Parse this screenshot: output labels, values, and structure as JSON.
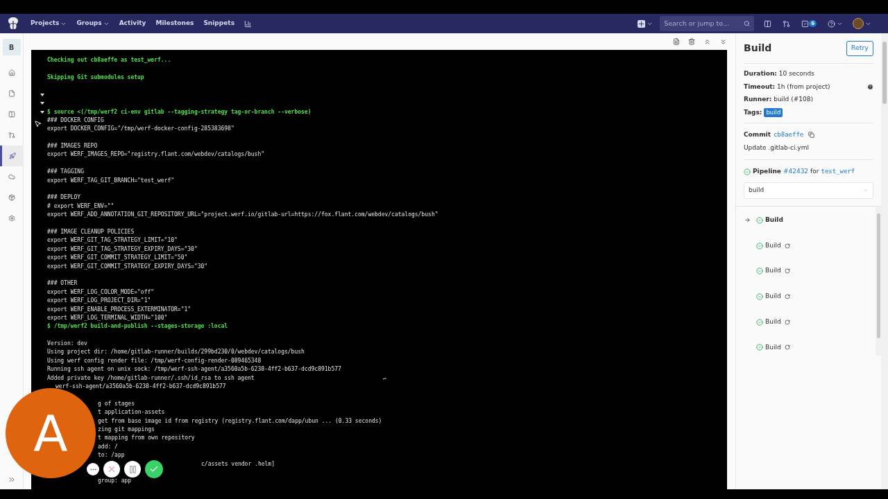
{
  "navbar": {
    "menus": [
      {
        "label": "Projects",
        "dropdown": true
      },
      {
        "label": "Groups",
        "dropdown": true
      },
      {
        "label": "Activity",
        "dropdown": false
      },
      {
        "label": "Milestones",
        "dropdown": false
      },
      {
        "label": "Snippets",
        "dropdown": false
      }
    ],
    "search": {
      "placeholder": "Search or jump to…"
    },
    "todo_count": "6"
  },
  "project_sidebar": {
    "avatar_letter": "B",
    "items": [
      {
        "kind": "home",
        "selected": false
      },
      {
        "kind": "repository",
        "selected": false
      },
      {
        "kind": "issues",
        "selected": false
      },
      {
        "kind": "merge-requests",
        "selected": false
      },
      {
        "kind": "ci-cd",
        "selected": true
      },
      {
        "kind": "operations",
        "selected": false
      },
      {
        "kind": "packages",
        "selected": false
      },
      {
        "kind": "settings",
        "selected": false
      }
    ]
  },
  "log": [
    {
      "kind": "command",
      "text": "Checking out cb8aeffe as test_werf..."
    },
    {
      "kind": "blank"
    },
    {
      "kind": "command",
      "text": "Skipping Git submodules setup"
    },
    {
      "kind": "blank"
    },
    {
      "kind": "section"
    },
    {
      "kind": "section"
    },
    {
      "kind": "section-command",
      "text": "$ source <(/tmp/werf2 ci-env gitlab --tagging-strategy tag-or-branch --verbose)"
    },
    {
      "kind": "output",
      "text": "### DOCKER CONFIG"
    },
    {
      "kind": "output",
      "text": "export DOCKER_CONFIG=\"/tmp/werf-docker-config-285383698\""
    },
    {
      "kind": "blank"
    },
    {
      "kind": "output",
      "text": "### IMAGES REPO"
    },
    {
      "kind": "output",
      "text": "export WERF_IMAGES_REPO=\"registry.flant.com/webdev/catalogs/bush\""
    },
    {
      "kind": "blank"
    },
    {
      "kind": "output",
      "text": "### TAGGING"
    },
    {
      "kind": "output",
      "text": "export WERF_TAG_GIT_BRANCH=\"test_werf\""
    },
    {
      "kind": "blank"
    },
    {
      "kind": "output",
      "text": "### DEPLOY"
    },
    {
      "kind": "output",
      "text": "# export WERF_ENV=\"\""
    },
    {
      "kind": "output",
      "text": "export WERF_ADD_ANNOTATION_GIT_REPOSITORY_URL=\"project.werf.io/gitlab-url=https://fox.flant.com/webdev/catalogs/bush\""
    },
    {
      "kind": "blank"
    },
    {
      "kind": "output",
      "text": "### IMAGE CLEANUP POLICIES"
    },
    {
      "kind": "output",
      "text": "export WERF_GIT_TAG_STRATEGY_LIMIT=\"10\""
    },
    {
      "kind": "output",
      "text": "export WERF_GIT_TAG_STRATEGY_EXPIRY_DAYS=\"30\""
    },
    {
      "kind": "output",
      "text": "export WERF_GIT_COMMIT_STRATEGY_LIMIT=\"50\""
    },
    {
      "kind": "output",
      "text": "export WERF_GIT_COMMIT_STRATEGY_EXPIRY_DAYS=\"30\""
    },
    {
      "kind": "blank"
    },
    {
      "kind": "output",
      "text": "### OTHER"
    },
    {
      "kind": "output",
      "text": "export WERF_LOG_COLOR_MODE=\"off\""
    },
    {
      "kind": "output",
      "text": "export WERF_LOG_PROJECT_DIR=\"1\""
    },
    {
      "kind": "output",
      "text": "export WERF_ENABLE_PROCESS_EXTERMINATOR=\"1\""
    },
    {
      "kind": "output",
      "text": "export WERF_LOG_TERMINAL_WIDTH=\"100\""
    },
    {
      "kind": "command",
      "text": "$ /tmp/werf2 build-and-publish --stages-storage :local"
    },
    {
      "kind": "blank"
    },
    {
      "kind": "output",
      "text": "Version: dev"
    },
    {
      "kind": "output",
      "text": "Using project dir: /home/gitlab-runner/builds/299bd230/0/webdev/catalogs/bush"
    },
    {
      "kind": "output",
      "text": "Using werf config render file: /tmp/werf-config-render-089465348"
    },
    {
      "kind": "output",
      "text": "Running ssh agent on unix sock: /tmp/werf-ssh-agent/a3560a5b-6238-4ff2-b637-dcd9c891b577"
    },
    {
      "kind": "output",
      "text": "Added private key /home/gitlab-runner/.ssh/id_rsa to ssh agent",
      "mark": "↵"
    },
    {
      "kind": "covered-near",
      "text": "werf-ssh-agent/a3560a5b-6238-4ff2-b637-dcd9c891b577"
    },
    {
      "kind": "blank"
    },
    {
      "kind": "covered",
      "text": "g of stages"
    },
    {
      "kind": "covered",
      "text": "t application-assets"
    },
    {
      "kind": "covered",
      "text": "get from base image id from registry (registry.flant.com/dapp/ubun ... (0.33 seconds)"
    },
    {
      "kind": "covered",
      "text": "zing git mappings"
    },
    {
      "kind": "covered",
      "text": "t mapping from own repository"
    },
    {
      "kind": "covered",
      "text": "add: /"
    },
    {
      "kind": "covered",
      "text": "to: /app"
    },
    {
      "kind": "covered-far",
      "text": "c/assets vendor .helm]"
    },
    {
      "kind": "blank"
    },
    {
      "kind": "covered",
      "text": "group: app"
    }
  ],
  "job_sidebar": {
    "title": "Build",
    "retry_button": "Retry",
    "details": [
      {
        "label": "Duration:",
        "value": "10 seconds"
      },
      {
        "label": "Timeout:",
        "value": "1h (from project)"
      },
      {
        "label": "Runner:",
        "value": "build (#108)"
      }
    ],
    "tags_label": "Tags:",
    "tags": [
      "build"
    ],
    "commit": {
      "label": "Commit",
      "sha": "cb8aeffe",
      "message": "Update .gitlab-ci.yml"
    },
    "pipeline": {
      "label": "Pipeline",
      "number": "#42432",
      "for": "for",
      "ref": "test_werf"
    },
    "stage_select": "build",
    "jobs": [
      {
        "name": "Build",
        "selected": true,
        "retried": false
      },
      {
        "name": "Build",
        "selected": false,
        "retried": true
      },
      {
        "name": "Build",
        "selected": false,
        "retried": true
      },
      {
        "name": "Build",
        "selected": false,
        "retried": true
      },
      {
        "name": "Build",
        "selected": false,
        "retried": true
      },
      {
        "name": "Build",
        "selected": false,
        "retried": true
      }
    ]
  },
  "recorder": {
    "avatar_letter": "A"
  }
}
